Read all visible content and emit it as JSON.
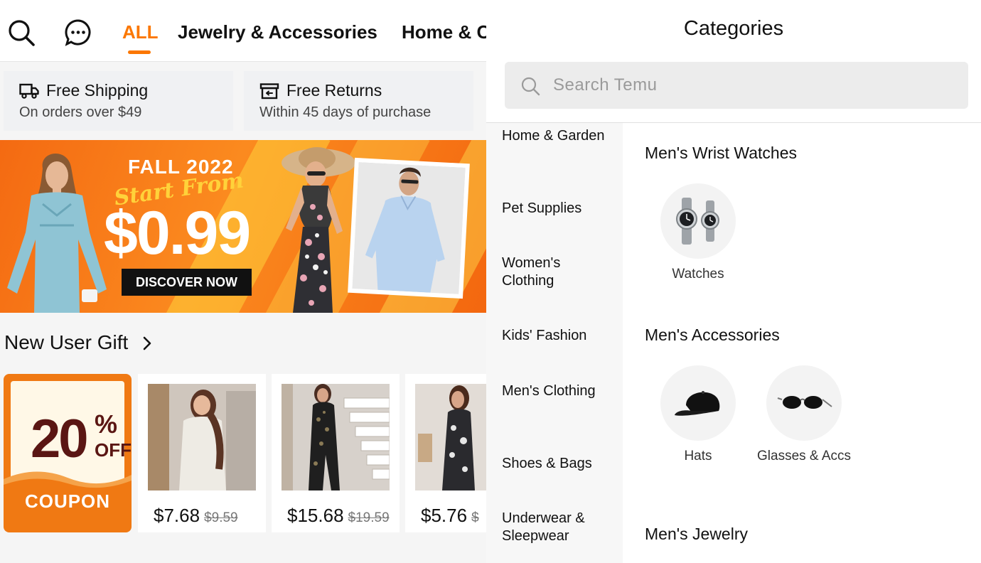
{
  "left": {
    "tabs": [
      {
        "label": "ALL",
        "active": true
      },
      {
        "label": "Jewelry & Accessories",
        "active": false
      },
      {
        "label": "Home & C",
        "active": false
      }
    ],
    "perks": [
      {
        "title": "Free Shipping",
        "subtitle": "On orders over $49",
        "icon": "truck-icon"
      },
      {
        "title": "Free Returns",
        "subtitle": "Within 45 days of purchase",
        "icon": "return-box-icon"
      }
    ],
    "banner": {
      "line1": "FALL 2022",
      "line2": "Start From",
      "price": "$0.99",
      "cta": "DISCOVER NOW"
    },
    "new_user_gift": {
      "label": "New User Gift",
      "coupon": {
        "percent": "20",
        "symbol": "%",
        "off": "OFF",
        "label": "COUPON"
      },
      "products": [
        {
          "price": "$7.68",
          "old_price": "$9.59"
        },
        {
          "price": "$15.68",
          "old_price": "$19.59"
        },
        {
          "price": "$5.76",
          "old_price": "$"
        }
      ]
    }
  },
  "right": {
    "title": "Categories",
    "search_placeholder": "Search Temu",
    "sidebar": [
      "Home & Garden",
      "Pet Supplies",
      "Women's Clothing",
      "Kids' Fashion",
      "Men's Clothing",
      "Shoes & Bags",
      "Underwear & Sleepwear"
    ],
    "sections": [
      {
        "title": "Men's Wrist Watches",
        "items": [
          {
            "label": "Watches",
            "icon": "watch-icon"
          }
        ]
      },
      {
        "title": "Men's Accessories",
        "items": [
          {
            "label": "Hats",
            "icon": "cap-icon"
          },
          {
            "label": "Glasses & Accs",
            "icon": "sunglasses-icon"
          }
        ]
      },
      {
        "title": "Men's Jewelry",
        "items": []
      }
    ]
  },
  "colors": {
    "accent": "#fb7701",
    "banner": "#f46a12",
    "coupon": "#f07913",
    "coupon_text": "#5a1613"
  }
}
